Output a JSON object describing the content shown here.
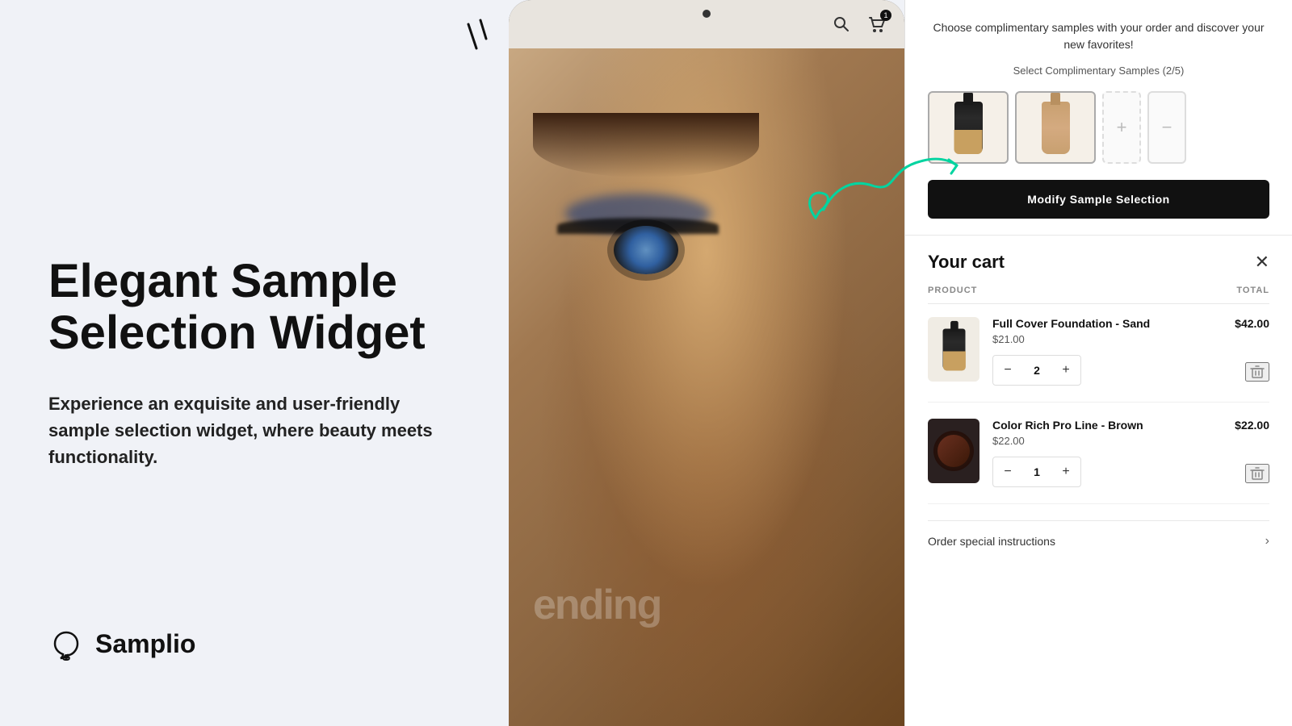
{
  "background": {
    "color": "#f0f2f7"
  },
  "hero": {
    "title": "Elegant Sample Selection Widget",
    "description": "Experience an exquisite and user-friendly sample selection widget, where beauty meets functionality."
  },
  "logo": {
    "name": "Samplio"
  },
  "tablet": {
    "camera_label": "camera",
    "trending_text": "ending"
  },
  "sample_widget": {
    "title": "Choose complimentary samples with your order and discover your new favorites!",
    "subtitle": "Select Complimentary Samples (2/5)",
    "modify_btn_label": "Modify Sample Selection",
    "sample_items": [
      {
        "id": 1,
        "type": "foundation-dark",
        "selected": true
      },
      {
        "id": 2,
        "type": "foundation-tan",
        "selected": true
      },
      {
        "id": 3,
        "type": "empty-add"
      },
      {
        "id": 4,
        "type": "empty-remove"
      }
    ]
  },
  "cart": {
    "title": "Your cart",
    "close_label": "×",
    "columns": {
      "product": "PRODUCT",
      "total": "TOTAL"
    },
    "items": [
      {
        "id": 1,
        "name": "Full Cover Foundation - Sand",
        "unit_price": "$21.00",
        "quantity": 2,
        "total": "$42.00",
        "img_type": "foundation-dark"
      },
      {
        "id": 2,
        "name": "Color Rich Pro Line - Brown",
        "unit_price": "$22.00",
        "quantity": 1,
        "total": "$22.00",
        "img_type": "eyeshadow"
      }
    ],
    "order_instructions_label": "Order special instructions"
  },
  "icons": {
    "search": "🔍",
    "cart": "🛒",
    "plus": "+",
    "minus": "−",
    "delete": "🗑",
    "close": "✕",
    "chevron_down": "›"
  }
}
